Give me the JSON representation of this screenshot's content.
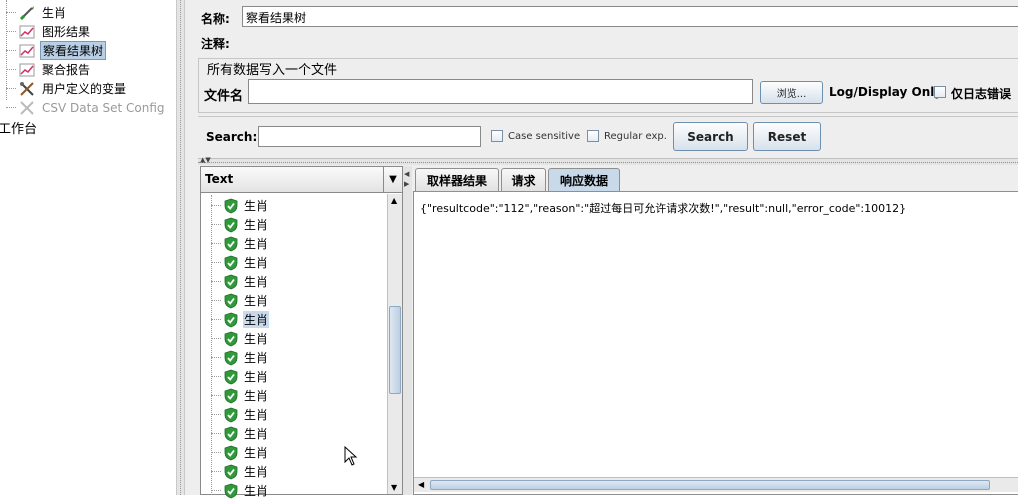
{
  "tree": {
    "items": [
      {
        "label": "生肖",
        "icon": "sampler-pen-icon"
      },
      {
        "label": "图形结果",
        "icon": "graph-results-icon"
      },
      {
        "label": "察看结果树",
        "icon": "view-results-tree-icon",
        "selected": true
      },
      {
        "label": "聚合报告",
        "icon": "aggregate-report-icon"
      },
      {
        "label": "用户定义的变量",
        "icon": "user-variables-icon"
      },
      {
        "label": "CSV Data Set Config",
        "icon": "csv-config-icon",
        "disabled": true
      }
    ],
    "workbench_label": "工作台"
  },
  "form": {
    "name_label": "名称:",
    "name_value": "察看结果树",
    "comment_label": "注释:",
    "file_group_title": "所有数据写入一个文件",
    "filename_label": "文件名",
    "filename_value": "",
    "browse_button": "浏览...",
    "log_display_label": "Log/Display Only:",
    "errors_only_label": "仅日志错误"
  },
  "search": {
    "label": "Search:",
    "value": "",
    "case_sensitive_label": "Case sensitive",
    "regex_label": "Regular exp.",
    "search_button": "Search",
    "reset_button": "Reset"
  },
  "results": {
    "renderer": "Text",
    "rows": [
      "生肖",
      "生肖",
      "生肖",
      "生肖",
      "生肖",
      "生肖",
      "生肖",
      "生肖",
      "生肖",
      "生肖",
      "生肖",
      "生肖",
      "生肖",
      "生肖",
      "生肖",
      "生肖"
    ],
    "selected_index": 6
  },
  "tabs": {
    "items": [
      "取样器结果",
      "请求",
      "响应数据"
    ],
    "active_index": 2
  },
  "response": {
    "text": "{\"resultcode\":\"112\",\"reason\":\"超过每日可允许请求次数!\",\"result\":null,\"error_code\":10012}"
  },
  "colors": {
    "selection": "#b8cfe5",
    "button_border": "#6d8fb0",
    "success_green": "#2f9a3a"
  }
}
